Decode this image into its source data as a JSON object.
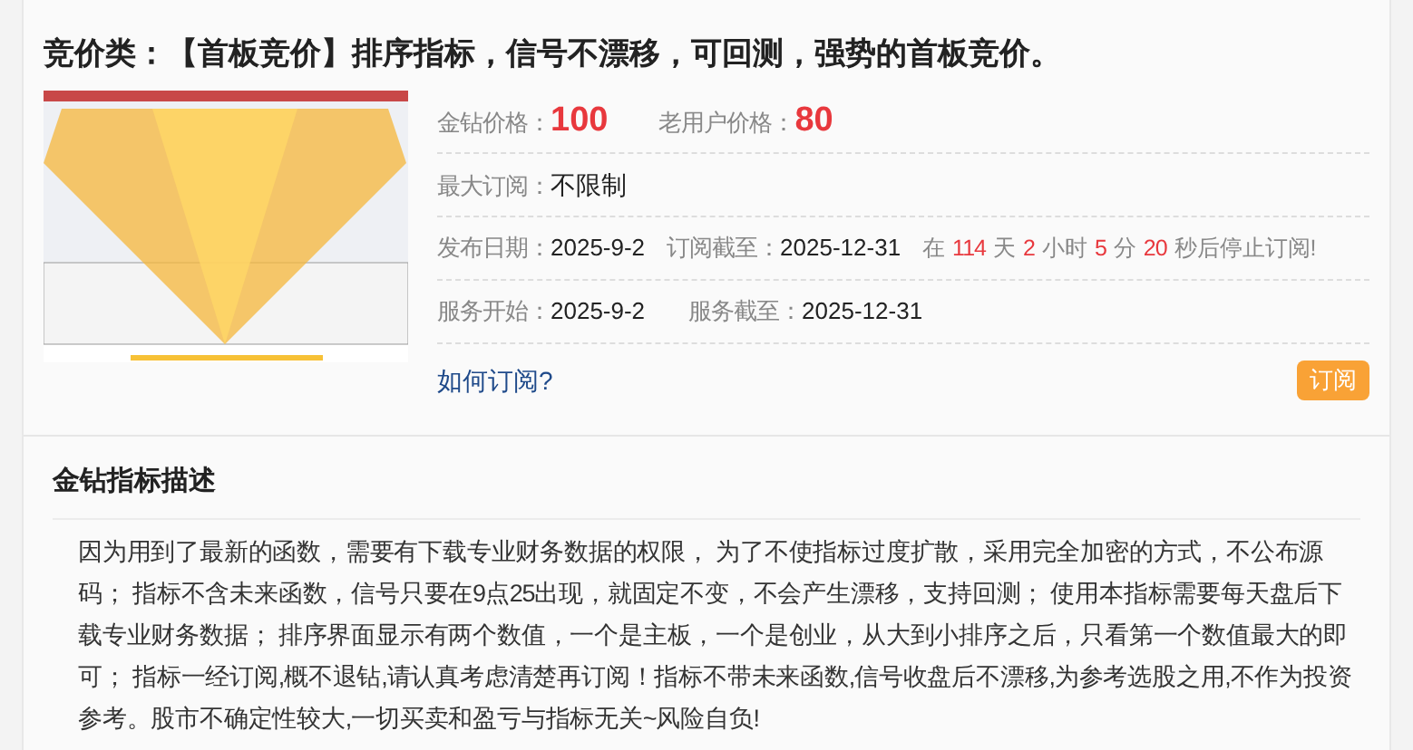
{
  "title": "竞价类：【首板竞价】排序指标，信号不漂移，可回测，强势的首板竞价。",
  "prices": [
    {
      "label": "金钻价格：",
      "value": "100"
    },
    {
      "label": "老用户价格：",
      "value": "80"
    }
  ],
  "max_subscription": {
    "label": "最大订阅：",
    "value": "不限制"
  },
  "dates": [
    {
      "label": "发布日期：",
      "value": "2025-9-2"
    },
    {
      "label": "订阅截至：",
      "value": "2025-12-31"
    }
  ],
  "countdown": [
    {
      "kind": "label",
      "text": "在"
    },
    {
      "kind": "value",
      "text": "114"
    },
    {
      "kind": "label",
      "text": "天"
    },
    {
      "kind": "value",
      "text": "2"
    },
    {
      "kind": "label",
      "text": "小时"
    },
    {
      "kind": "value",
      "text": "5"
    },
    {
      "kind": "label",
      "text": "分"
    },
    {
      "kind": "value",
      "text": "20"
    },
    {
      "kind": "label",
      "text": "秒后停止订阅!"
    }
  ],
  "service": [
    {
      "label": "服务开始：",
      "value": "2025-9-2"
    },
    {
      "label": "服务截至：",
      "value": "2025-12-31"
    }
  ],
  "how_link": "如何订阅?",
  "subscribe_button": "订阅",
  "description": {
    "heading": "金钻指标描述",
    "text": "因为用到了最新的函数，需要有下载专业财务数据的权限， 为了不使指标过度扩散，采用完全加密的方式，不公布源码； 指标不含未来函数，信号只要在9点25出现，就固定不变，不会产生漂移，支持回测； 使用本指标需要每天盘后下载专业财务数据； 排序界面显示有两个数值，一个是主板，一个是创业，从大到小排序之后，只看第一个数值最大的即可； 指标一经订阅,概不退钻,请认真考虑清楚再订阅！指标不带未来函数,信号收盘后不漂移,为参考选股之用,不作为投资参考。股市不确定性较大,一切买卖和盈亏与指标无关~风险自负!"
  }
}
